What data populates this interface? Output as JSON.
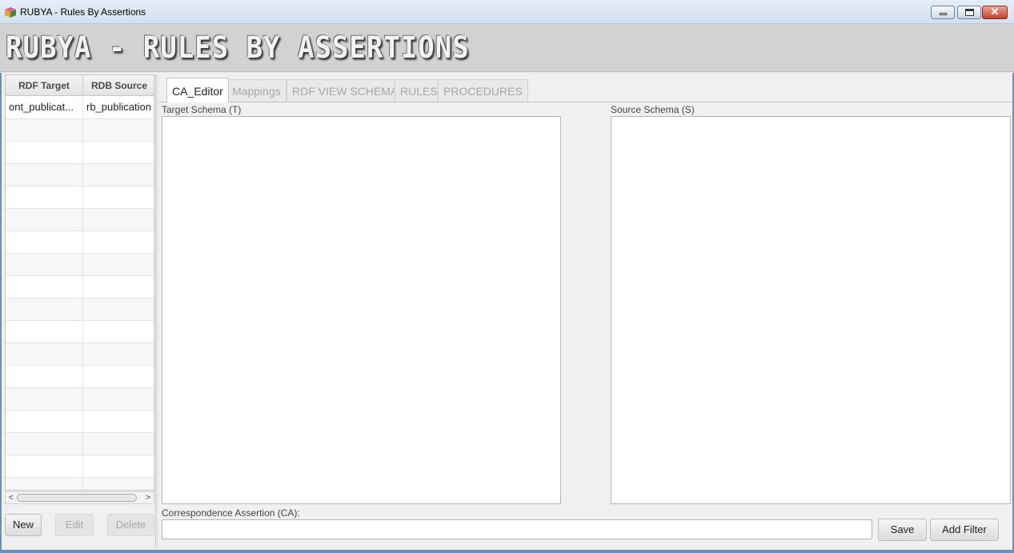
{
  "window": {
    "title": "RUBYA - Rules By Assertions",
    "controls": {
      "close": "✕"
    }
  },
  "banner": {
    "logo_text": "RUBYA - RULES BY ASSERTIONS"
  },
  "table": {
    "columns": [
      "RDF Target",
      "RDB Source"
    ],
    "rows": [
      [
        "ont_publicat...",
        "rb_publication"
      ],
      [
        "",
        ""
      ],
      [
        "",
        ""
      ],
      [
        "",
        ""
      ],
      [
        "",
        ""
      ],
      [
        "",
        ""
      ],
      [
        "",
        ""
      ],
      [
        "",
        ""
      ],
      [
        "",
        ""
      ],
      [
        "",
        ""
      ],
      [
        "",
        ""
      ],
      [
        "",
        ""
      ],
      [
        "",
        ""
      ],
      [
        "",
        ""
      ],
      [
        "",
        ""
      ],
      [
        "",
        ""
      ],
      [
        "",
        ""
      ],
      [
        "",
        ""
      ]
    ],
    "scroll_left": "<",
    "scroll_right": ">"
  },
  "left_buttons": {
    "new": "New",
    "edit": "Edit",
    "delete": "Delete"
  },
  "tabs": [
    {
      "label": "CA_Editor",
      "active": true
    },
    {
      "label": "Mappings",
      "active": false
    },
    {
      "label": "RDF VIEW SCHEMA",
      "active": false
    },
    {
      "label": "RULES",
      "active": false
    },
    {
      "label": "PROCEDURES",
      "active": false
    }
  ],
  "editor": {
    "target_label": "Target Schema (T)",
    "source_label": "Source Schema (S)",
    "ca_label": "Correspondence Assertion (CA):",
    "ca_value": "",
    "save_label": "Save",
    "add_filter_label": "Add Filter"
  }
}
